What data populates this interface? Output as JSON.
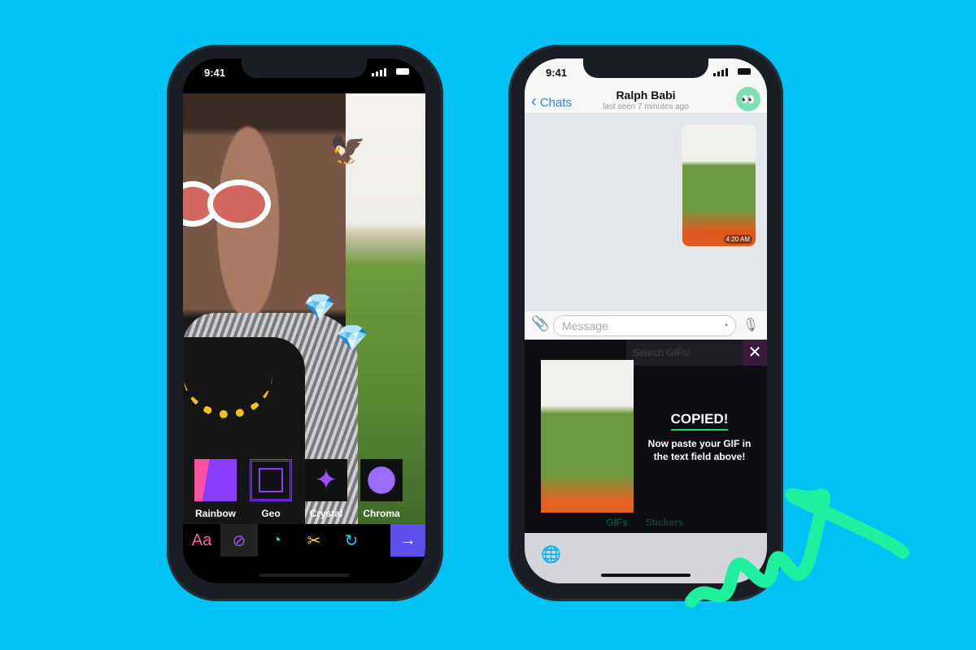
{
  "colors": {
    "background": "#00c2f4",
    "accent": "#5b50ee",
    "squiggle": "#1ef0a0",
    "link": "#2a84ee"
  },
  "left_phone": {
    "status_time": "9:41",
    "stickers": [
      {
        "label": "Rainbow"
      },
      {
        "label": "Geo"
      },
      {
        "label": "Crystal"
      },
      {
        "label": "Chroma"
      }
    ],
    "toolbar": [
      {
        "icon": "text-icon",
        "label": "Aa"
      },
      {
        "icon": "link-icon"
      },
      {
        "icon": "sticker-icon"
      },
      {
        "icon": "scissors-icon"
      },
      {
        "icon": "redo-icon"
      },
      {
        "icon": "arrow-right-icon"
      }
    ]
  },
  "right_phone": {
    "status_time": "9:41",
    "header": {
      "back": "Chats",
      "title": "Ralph Babi",
      "subtitle": "last seen 7 minutes ago",
      "avatar": "👀"
    },
    "message_time": "4:20 AM",
    "input_placeholder": "Message",
    "keyboard": {
      "search_placeholder": "Search GIFs!",
      "copied_title": "COPIED!",
      "copied_text": "Now paste your GIF in the text field above!",
      "tabs": [
        "GIFs",
        "Stickers"
      ]
    }
  }
}
